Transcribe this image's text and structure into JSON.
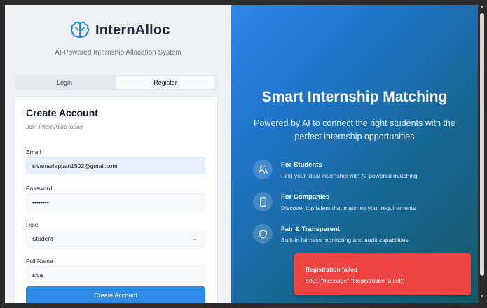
{
  "brand": {
    "name": "InternAlloc",
    "tagline": "AI-Powered Internship Allocation System"
  },
  "tabs": [
    {
      "label": "Login"
    },
    {
      "label": "Register"
    }
  ],
  "form": {
    "title": "Create Account",
    "subtitle": "Join InternAlloc today",
    "email_label": "Email",
    "email_value": "sivamariappan1502@gmail.com",
    "password_label": "Password",
    "password_value": "••••••••",
    "role_label": "Role",
    "role_value": "Student",
    "fullname_label": "Full Name",
    "fullname_value": "siva",
    "submit_label": "Create Account"
  },
  "hero": {
    "title": "Smart Internship Matching",
    "subtitle": "Powered by AI to connect the right students with the perfect internship opportunities"
  },
  "features": [
    {
      "title": "For Students",
      "desc": "Find your ideal internship with AI-powered matching",
      "icon": "users-icon"
    },
    {
      "title": "For Companies",
      "desc": "Discover top talent that matches your requirements",
      "icon": "building-icon"
    },
    {
      "title": "Fair & Transparent",
      "desc": "Built-in fairness monitoring and audit capabilities",
      "icon": "shield-icon"
    }
  ],
  "toast": {
    "title": "Registration failed",
    "message": "500: {\"message\":\"Registration failed\"}"
  },
  "colors": {
    "accent": "#2e8be6",
    "error": "#ef4444",
    "hero_start": "#2f86e8",
    "hero_end": "#145a6a"
  }
}
